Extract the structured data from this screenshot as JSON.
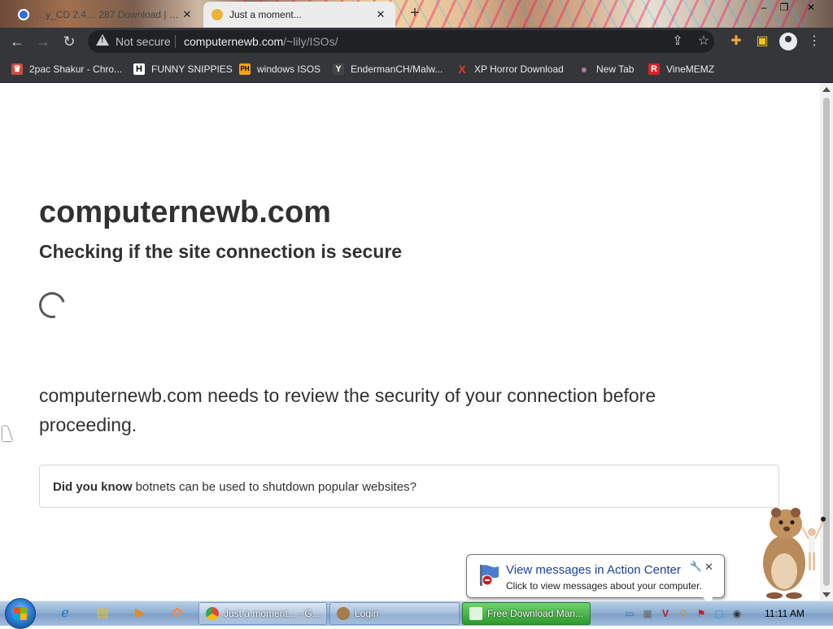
{
  "browser": {
    "tabs": [
      {
        "title": "…y_CD 2.4… 287 Download | …",
        "active": false
      },
      {
        "title": "Just a moment...",
        "active": true
      }
    ],
    "new_tab_glyph": "+",
    "window_controls": [
      "–",
      "❐",
      "✕"
    ],
    "security_label": "Not secure",
    "url_host": "computernewb.com",
    "url_path": "/~lily/ISOs/",
    "bookmarks": [
      {
        "label": "2pac Shakur - Chro...",
        "icon": "person-icon",
        "color": "#c94f3d",
        "glyph": "♛"
      },
      {
        "label": "FUNNY SNIPPIES",
        "icon": "h-icon",
        "color": "#ffffff",
        "glyph": "H"
      },
      {
        "label": "windows ISOS",
        "icon": "ph-icon",
        "color": "#f7a01d",
        "glyph": "PH"
      },
      {
        "label": "EndermanCH/Malw...",
        "icon": "yp-icon",
        "color": "#444444",
        "glyph": "Y"
      },
      {
        "label": "XP Horror Download",
        "icon": "x-icon",
        "color": "#e0372b",
        "glyph": "X"
      },
      {
        "label": "New Tab",
        "icon": "globe-icon",
        "color": "#b07aa1",
        "glyph": "●"
      },
      {
        "label": "VineMEMZ",
        "icon": "r-icon",
        "color": "#d4232b",
        "glyph": "R"
      }
    ]
  },
  "page": {
    "site": "computernewb.com",
    "subtitle": "Checking if the site connection is secure",
    "review_text": "computernewb.com needs to review the security of your connection before proceeding.",
    "tip_bold": "Did you know",
    "tip_text": "botnets can be used to shutdown popular websites?"
  },
  "notification": {
    "title": "View messages in Action Center",
    "subtitle": "Click to view messages about your computer.",
    "close": "✕",
    "wrench": "🔧"
  },
  "taskbar": {
    "tasks": [
      {
        "label": "Just a moment... - G...",
        "icon_color": "#e8b339"
      },
      {
        "label": "Login",
        "icon_color": "#a57a4d"
      },
      {
        "label": "Free Download Man...",
        "icon_color": "#4aa84a"
      }
    ],
    "clock": "11:11 AM"
  }
}
